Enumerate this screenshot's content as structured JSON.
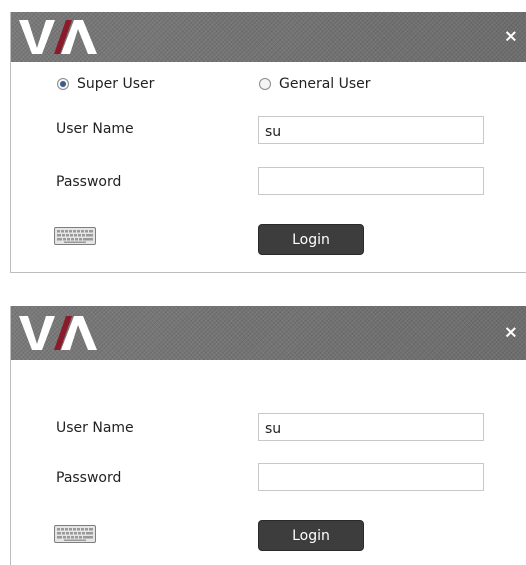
{
  "logo_text": "VIA",
  "close_glyph": "×",
  "colors": {
    "titlebar": "#6f6f6f",
    "logo_white": "#ffffff",
    "logo_accent": "#8b1a2a",
    "button_bg": "#3d3d3d"
  },
  "dialog1": {
    "radio": {
      "super_user": "Super User",
      "general_user": "General User",
      "selected": "Super User"
    },
    "username_label": "User Name",
    "username_value": "su",
    "password_label": "Password",
    "password_value": "",
    "login_label": "Login",
    "keyboard_icon": "keyboard-icon"
  },
  "dialog2": {
    "username_label": "User Name",
    "username_value": "su",
    "password_label": "Password",
    "password_value": "",
    "login_label": "Login",
    "keyboard_icon": "keyboard-icon"
  }
}
